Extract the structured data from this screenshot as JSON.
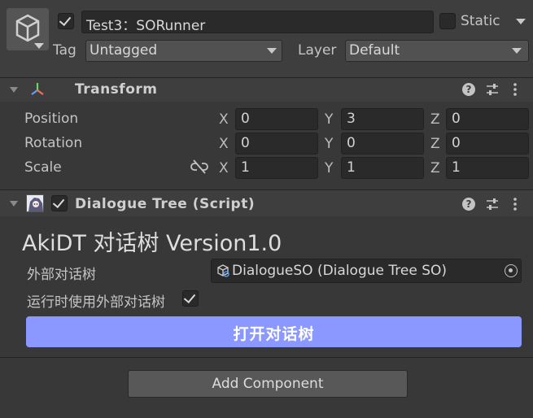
{
  "object": {
    "name": "Test3：SORunner",
    "active": true,
    "static_label": "Static",
    "static_checked": false,
    "tag_label": "Tag",
    "tag_value": "Untagged",
    "layer_label": "Layer",
    "layer_value": "Default"
  },
  "transform": {
    "title": "Transform",
    "rows": [
      {
        "label": "Position",
        "x": "0",
        "y": "3",
        "z": "0"
      },
      {
        "label": "Rotation",
        "x": "0",
        "y": "0",
        "z": "0"
      },
      {
        "label": "Scale",
        "x": "1",
        "y": "1",
        "z": "1"
      }
    ],
    "axis_x": "X",
    "axis_y": "Y",
    "axis_z": "Z"
  },
  "component": {
    "title": "Dialogue Tree (Script)",
    "enabled": true,
    "heading": "AkiDT 对话树 Version1.0",
    "field_label": "外部对话树",
    "field_value": "DialogueSO (Dialogue Tree SO)",
    "toggle_label": "运行时使用外部对话树",
    "toggle_checked": true,
    "open_button": "打开对话树"
  },
  "add_component": "Add Component",
  "colors": {
    "background": "#383838",
    "header": "#3e3e3e",
    "field": "#2a2a2a",
    "accent_button": "#8b98ff"
  }
}
